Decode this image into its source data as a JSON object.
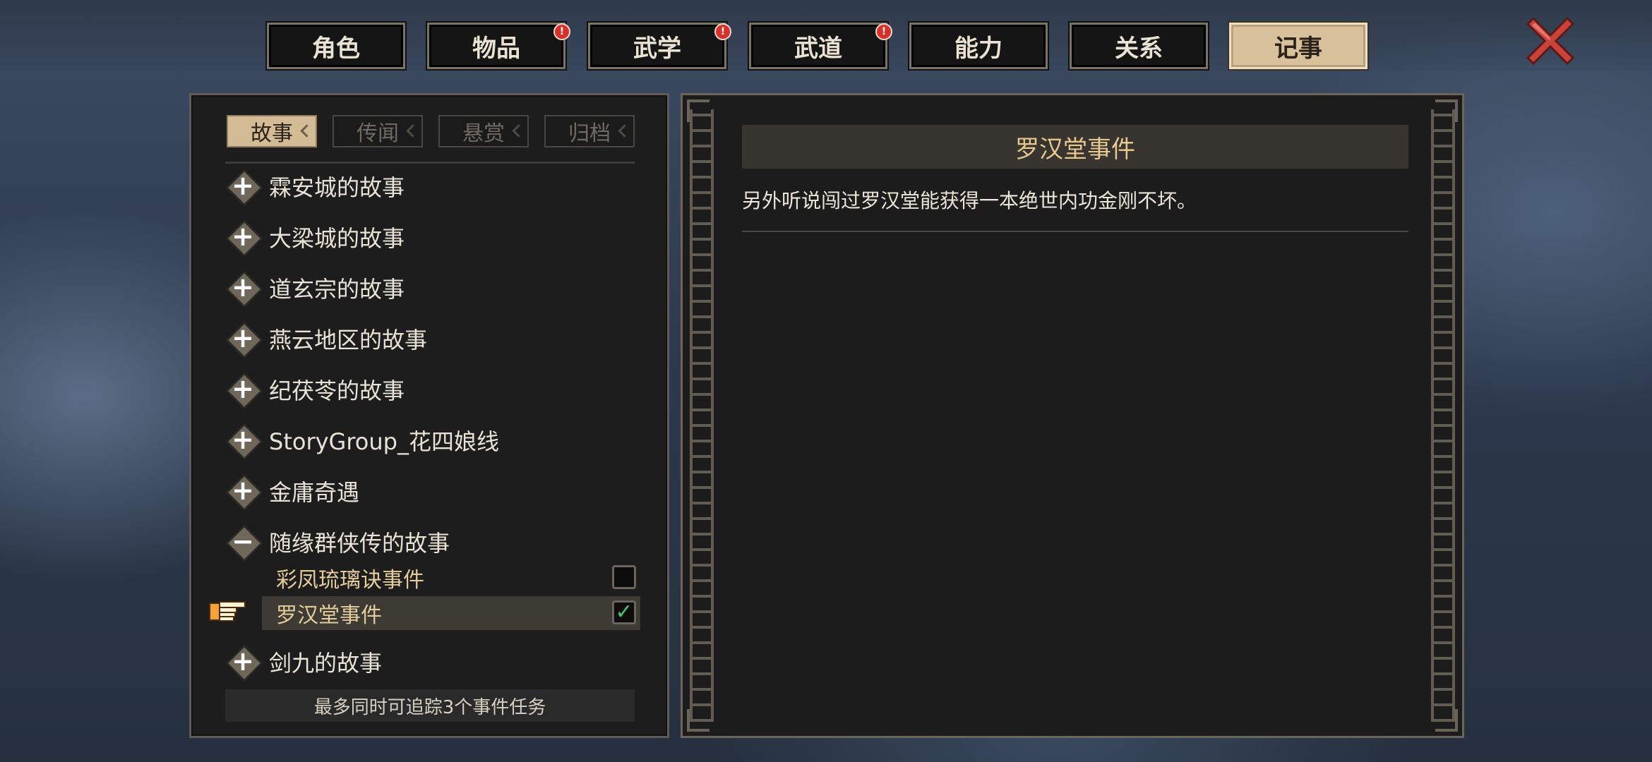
{
  "top_tabs": [
    {
      "label": "角色",
      "alert": false,
      "active": false
    },
    {
      "label": "物品",
      "alert": true,
      "active": false
    },
    {
      "label": "武学",
      "alert": true,
      "active": false
    },
    {
      "label": "武道",
      "alert": true,
      "active": false
    },
    {
      "label": "能力",
      "alert": false,
      "active": false
    },
    {
      "label": "关系",
      "alert": false,
      "active": false
    },
    {
      "label": "记事",
      "alert": false,
      "active": true
    }
  ],
  "alert_badge": "!",
  "sub_tabs": [
    {
      "label": "故事",
      "active": true
    },
    {
      "label": "传闻",
      "active": false
    },
    {
      "label": "悬赏",
      "active": false
    },
    {
      "label": "归档",
      "active": false
    }
  ],
  "story_list": {
    "groups": [
      {
        "label": "霖安城的故事",
        "expanded": false
      },
      {
        "label": "大梁城的故事",
        "expanded": false
      },
      {
        "label": "道玄宗的故事",
        "expanded": false
      },
      {
        "label": "燕云地区的故事",
        "expanded": false
      },
      {
        "label": "纪茯苓的故事",
        "expanded": false
      },
      {
        "label": "StoryGroup_花四娘线",
        "expanded": false
      },
      {
        "label": "金庸奇遇",
        "expanded": false
      },
      {
        "label": "随缘群侠传的故事",
        "expanded": true
      },
      {
        "label": "剑九的故事",
        "expanded": false
      }
    ],
    "expand_symbol": "+",
    "collapse_symbol": "−",
    "sub_items": [
      {
        "label": "彩凤琉璃诀事件",
        "tracked": false,
        "selected": false
      },
      {
        "label": "罗汉堂事件",
        "tracked": true,
        "selected": true
      }
    ],
    "check_mark": "✓",
    "footer_note": "最多同时可追踪3个事件任务"
  },
  "detail": {
    "title": "罗汉堂事件",
    "description": "另外听说闯过罗汉堂能获得一本绝世内功金刚不坏。"
  },
  "colors": {
    "active_tab_bg": "#d9c19c",
    "accent_gold": "#e7c98f",
    "check_green": "#4fc06a",
    "alert_red": "#d6322b",
    "close_red": "#c9433b"
  },
  "icons": {
    "close": "close-x-icon",
    "pointer": "pointing-hand-icon"
  }
}
